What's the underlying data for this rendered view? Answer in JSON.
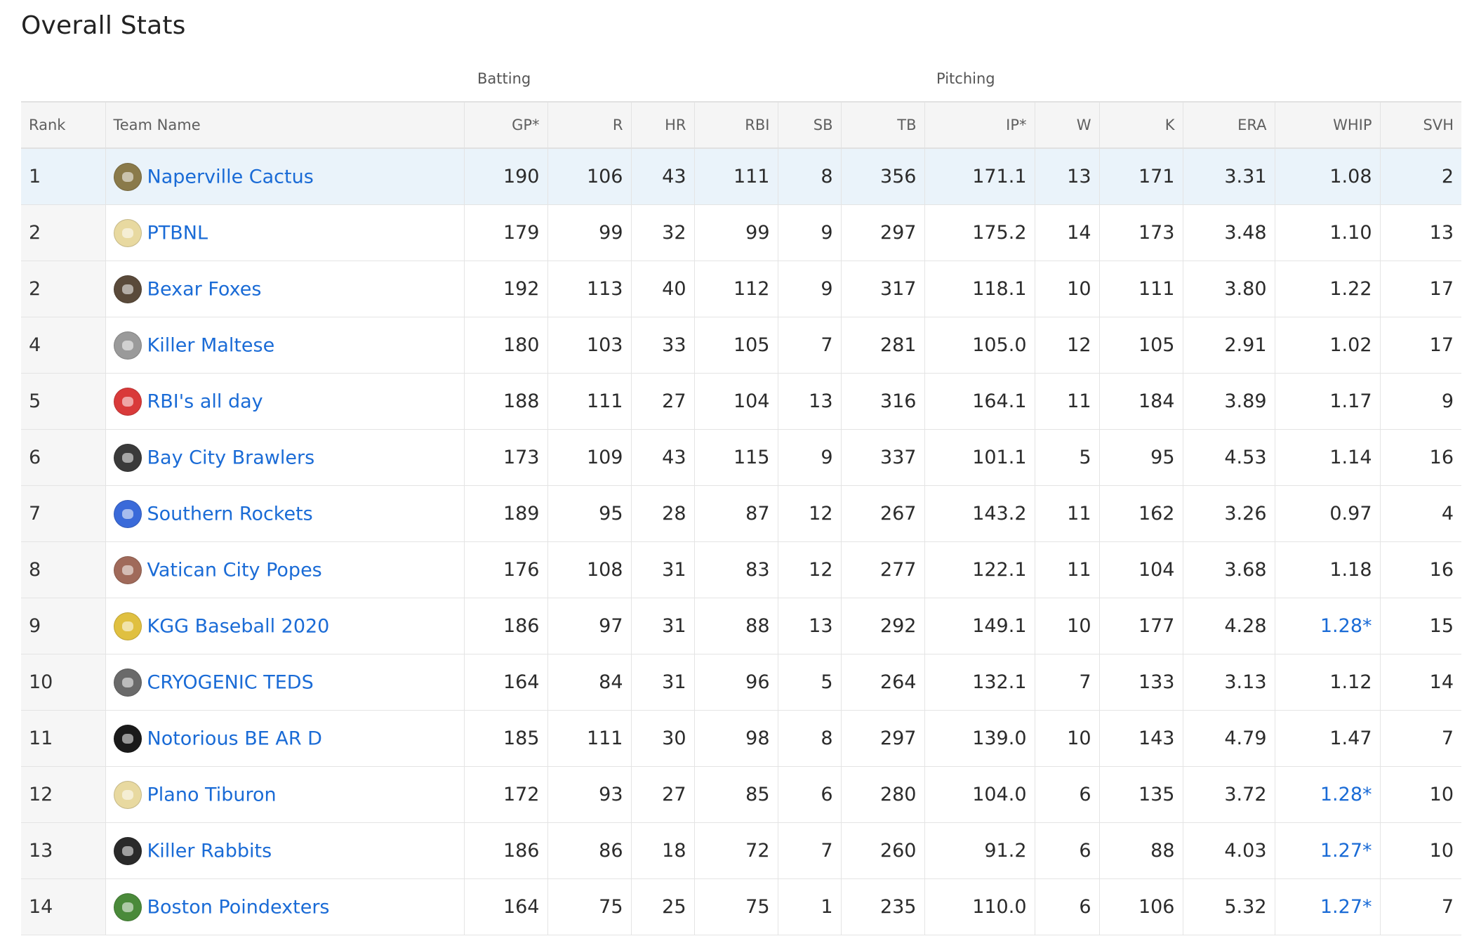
{
  "page_title": "Overall Stats",
  "groups": {
    "batting": "Batting",
    "pitching": "Pitching"
  },
  "columns": [
    "Rank",
    "Team Name",
    "GP*",
    "R",
    "HR",
    "RBI",
    "SB",
    "TB",
    "IP*",
    "W",
    "K",
    "ERA",
    "WHIP",
    "SVH"
  ],
  "colors": {
    "link": "#1a6bd6",
    "highlight_row": "#eaf3fa",
    "header_bg": "#f5f5f5"
  },
  "rows": [
    {
      "rank": "1",
      "team": "Naperville Cactus",
      "logo": "#8a7a4a",
      "gp": "190",
      "r": "106",
      "hr": "43",
      "rbi": "111",
      "sb": "8",
      "tb": "356",
      "ip": "171.1",
      "w": "13",
      "k": "171",
      "era": "3.31",
      "whip": "1.08",
      "whip_flag": false,
      "svh": "2"
    },
    {
      "rank": "2",
      "team": "PTBNL",
      "logo": "#e8d9a0",
      "gp": "179",
      "r": "99",
      "hr": "32",
      "rbi": "99",
      "sb": "9",
      "tb": "297",
      "ip": "175.2",
      "w": "14",
      "k": "173",
      "era": "3.48",
      "whip": "1.10",
      "whip_flag": false,
      "svh": "13"
    },
    {
      "rank": "2",
      "team": "Bexar Foxes",
      "logo": "#5a4a3a",
      "gp": "192",
      "r": "113",
      "hr": "40",
      "rbi": "112",
      "sb": "9",
      "tb": "317",
      "ip": "118.1",
      "w": "10",
      "k": "111",
      "era": "3.80",
      "whip": "1.22",
      "whip_flag": false,
      "svh": "17"
    },
    {
      "rank": "4",
      "team": "Killer Maltese",
      "logo": "#9a9a9a",
      "gp": "180",
      "r": "103",
      "hr": "33",
      "rbi": "105",
      "sb": "7",
      "tb": "281",
      "ip": "105.0",
      "w": "12",
      "k": "105",
      "era": "2.91",
      "whip": "1.02",
      "whip_flag": false,
      "svh": "17"
    },
    {
      "rank": "5",
      "team": "RBI's all day",
      "logo": "#d93a3a",
      "gp": "188",
      "r": "111",
      "hr": "27",
      "rbi": "104",
      "sb": "13",
      "tb": "316",
      "ip": "164.1",
      "w": "11",
      "k": "184",
      "era": "3.89",
      "whip": "1.17",
      "whip_flag": false,
      "svh": "9"
    },
    {
      "rank": "6",
      "team": "Bay City Brawlers",
      "logo": "#3a3a3a",
      "gp": "173",
      "r": "109",
      "hr": "43",
      "rbi": "115",
      "sb": "9",
      "tb": "337",
      "ip": "101.1",
      "w": "5",
      "k": "95",
      "era": "4.53",
      "whip": "1.14",
      "whip_flag": false,
      "svh": "16"
    },
    {
      "rank": "7",
      "team": "Southern Rockets",
      "logo": "#3a6ad9",
      "gp": "189",
      "r": "95",
      "hr": "28",
      "rbi": "87",
      "sb": "12",
      "tb": "267",
      "ip": "143.2",
      "w": "11",
      "k": "162",
      "era": "3.26",
      "whip": "0.97",
      "whip_flag": false,
      "svh": "4"
    },
    {
      "rank": "8",
      "team": "Vatican City Popes",
      "logo": "#a06a5a",
      "gp": "176",
      "r": "108",
      "hr": "31",
      "rbi": "83",
      "sb": "12",
      "tb": "277",
      "ip": "122.1",
      "w": "11",
      "k": "104",
      "era": "3.68",
      "whip": "1.18",
      "whip_flag": false,
      "svh": "16"
    },
    {
      "rank": "9",
      "team": "KGG Baseball 2020",
      "logo": "#e0c040",
      "gp": "186",
      "r": "97",
      "hr": "31",
      "rbi": "88",
      "sb": "13",
      "tb": "292",
      "ip": "149.1",
      "w": "10",
      "k": "177",
      "era": "4.28",
      "whip": "1.28*",
      "whip_flag": true,
      "svh": "15"
    },
    {
      "rank": "10",
      "team": "CRYOGENIC TEDS",
      "logo": "#6a6a6a",
      "gp": "164",
      "r": "84",
      "hr": "31",
      "rbi": "96",
      "sb": "5",
      "tb": "264",
      "ip": "132.1",
      "w": "7",
      "k": "133",
      "era": "3.13",
      "whip": "1.12",
      "whip_flag": false,
      "svh": "14"
    },
    {
      "rank": "11",
      "team": "Notorious BE AR D",
      "logo": "#1a1a1a",
      "gp": "185",
      "r": "111",
      "hr": "30",
      "rbi": "98",
      "sb": "8",
      "tb": "297",
      "ip": "139.0",
      "w": "10",
      "k": "143",
      "era": "4.79",
      "whip": "1.47",
      "whip_flag": false,
      "svh": "7"
    },
    {
      "rank": "12",
      "team": "Plano Tiburon",
      "logo": "#e8d9a0",
      "gp": "172",
      "r": "93",
      "hr": "27",
      "rbi": "85",
      "sb": "6",
      "tb": "280",
      "ip": "104.0",
      "w": "6",
      "k": "135",
      "era": "3.72",
      "whip": "1.28*",
      "whip_flag": true,
      "svh": "10"
    },
    {
      "rank": "13",
      "team": "Killer Rabbits",
      "logo": "#2a2a2a",
      "gp": "186",
      "r": "86",
      "hr": "18",
      "rbi": "72",
      "sb": "7",
      "tb": "260",
      "ip": "91.2",
      "w": "6",
      "k": "88",
      "era": "4.03",
      "whip": "1.27*",
      "whip_flag": true,
      "svh": "10"
    },
    {
      "rank": "14",
      "team": "Boston Poindexters",
      "logo": "#4a8a3a",
      "gp": "164",
      "r": "75",
      "hr": "25",
      "rbi": "75",
      "sb": "1",
      "tb": "235",
      "ip": "110.0",
      "w": "6",
      "k": "106",
      "era": "5.32",
      "whip": "1.27*",
      "whip_flag": true,
      "svh": "7"
    }
  ]
}
